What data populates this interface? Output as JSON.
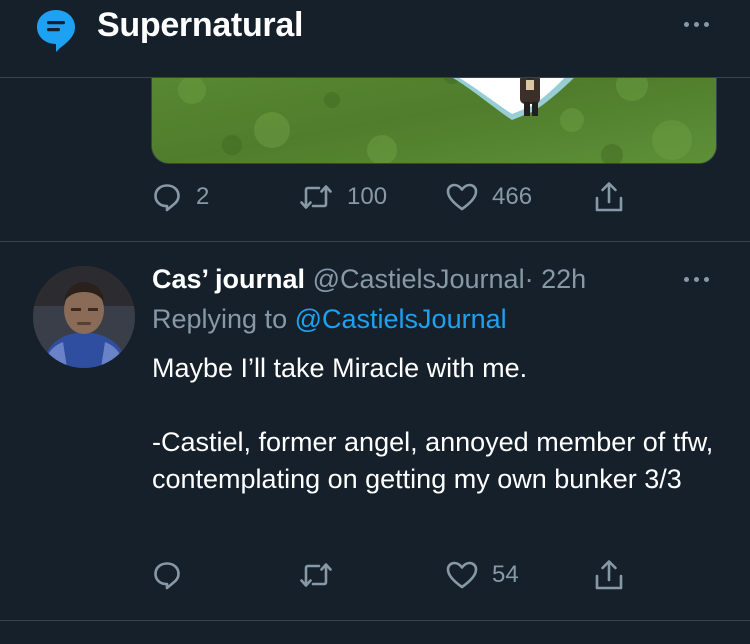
{
  "topic": {
    "title": "Supernatural"
  },
  "previous_tweet": {
    "replies": "2",
    "retweets": "100",
    "likes": "466"
  },
  "tweet": {
    "author_name": "Cas’ journal",
    "author_handle": "@CastielsJournal",
    "separator": "·",
    "time": "22h",
    "replying_prefix": "Replying to",
    "replying_to": "@CastielsJournal",
    "body_line_1": "Maybe I’ll take Miracle with me.",
    "body_line_2": "-Castiel, former angel, annoyed member of tfw, contemplating on getting my own bunker 3/3",
    "replies": "",
    "retweets": "",
    "likes": "54"
  },
  "colors": {
    "background": "#15202b",
    "muted": "#8899a6",
    "accent": "#1da1f2",
    "divider": "#38444d"
  },
  "icons": {
    "topic": "topic-icon",
    "more": "more-icon",
    "reply": "reply-icon",
    "retweet": "retweet-icon",
    "like": "heart-icon",
    "share": "share-icon"
  }
}
